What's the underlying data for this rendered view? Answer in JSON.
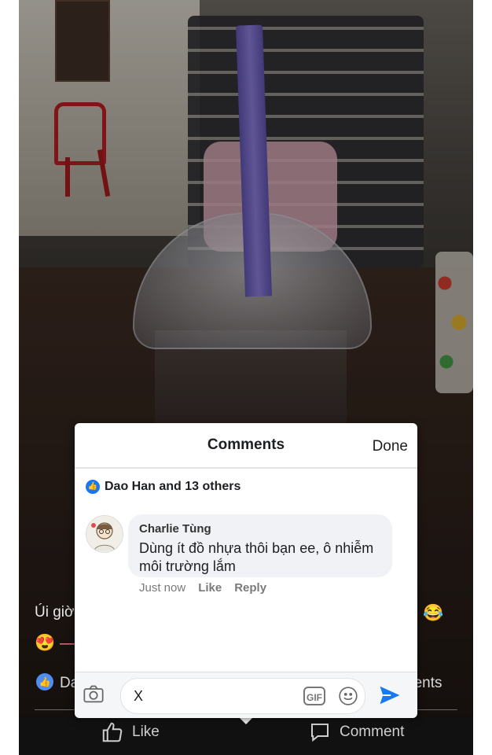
{
  "background": {
    "caption_start": "Úi giờ",
    "caption_emoji": "😂",
    "row2": "😍 —",
    "likes_partial": "Da",
    "comments_partial": "nents",
    "like_label": "Like",
    "comment_label": "Comment"
  },
  "comments_panel": {
    "title": "Comments",
    "done_label": "Done",
    "likes_text": "Dao Han and 13 others",
    "comment": {
      "author": "Charlie Tùng",
      "text": "Dùng ít đồ nhựa thôi bạn ee, ô nhiễm môi trường lắm",
      "time": "Just now",
      "like_action": "Like",
      "reply_action": "Reply"
    },
    "composer": {
      "value": "X",
      "gif_label": "GIF"
    }
  },
  "colors": {
    "accent": "#1877f2",
    "bubble": "#f0f2f5"
  }
}
